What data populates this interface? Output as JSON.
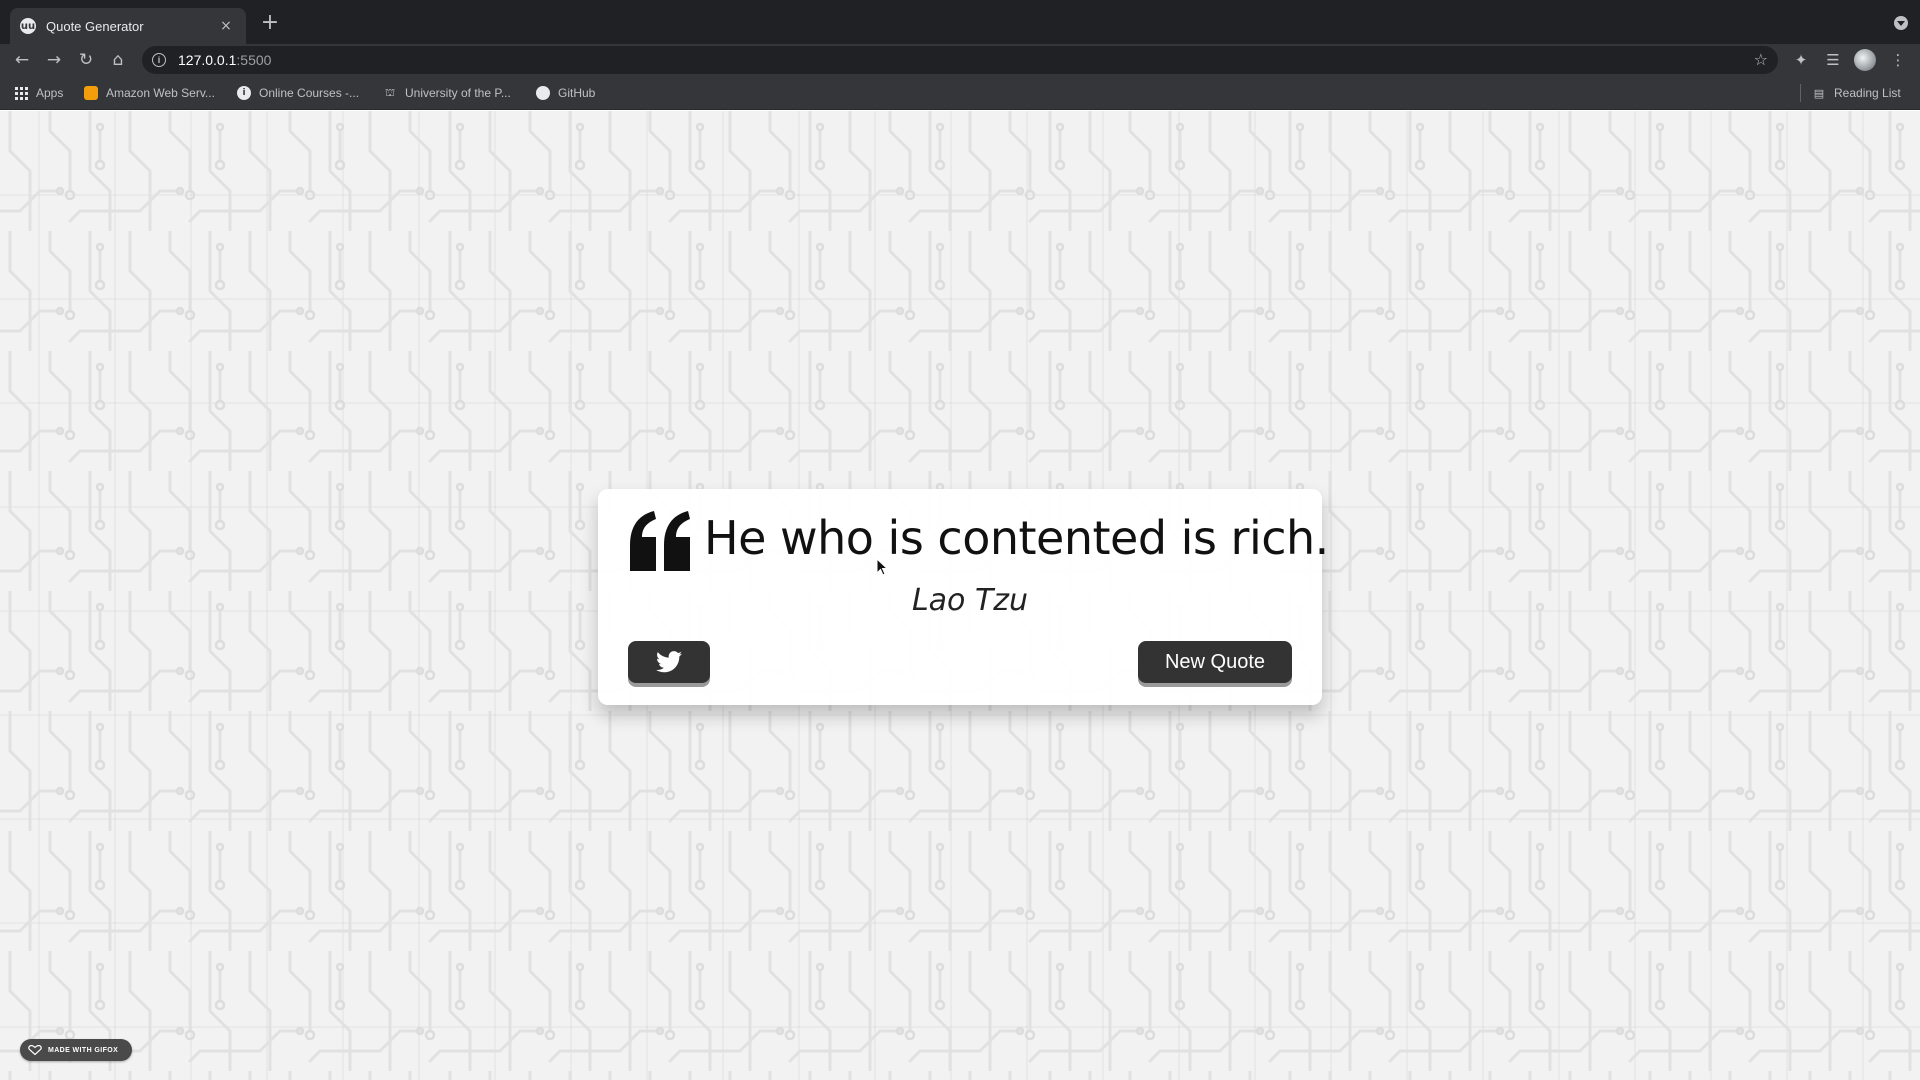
{
  "browser": {
    "tab": {
      "title": "Quote Generator",
      "favicon_text": "uu",
      "close_glyph": "×"
    },
    "new_tab_glyph": "+",
    "nav": {
      "back_glyph": "←",
      "forward_glyph": "→",
      "reload_glyph": "↻",
      "home_glyph": "⌂"
    },
    "address": {
      "host": "127.0.0.1",
      "port": ":5500"
    },
    "bookmarks": [
      {
        "label": "Apps",
        "icon": "apps-grid-icon"
      },
      {
        "label": "Amazon Web Serv...",
        "icon": "aws-icon"
      },
      {
        "label": "Online Courses -...",
        "icon": "online-courses-icon"
      },
      {
        "label": "University of the P...",
        "icon": "university-icon"
      },
      {
        "label": "GitHub",
        "icon": "github-icon"
      }
    ],
    "reading_list_label": "Reading List"
  },
  "quote": {
    "text": "He who is contented is rich.",
    "author": "Lao Tzu"
  },
  "buttons": {
    "new_quote_label": "New Quote",
    "twitter_icon": "twitter-icon"
  },
  "badge": {
    "label": "MADE WITH GIFOX"
  },
  "colors": {
    "chrome_dark": "#202124",
    "chrome_toolbar": "#35363a",
    "button_bg": "#333333",
    "page_bg": "#f2f2f2"
  }
}
